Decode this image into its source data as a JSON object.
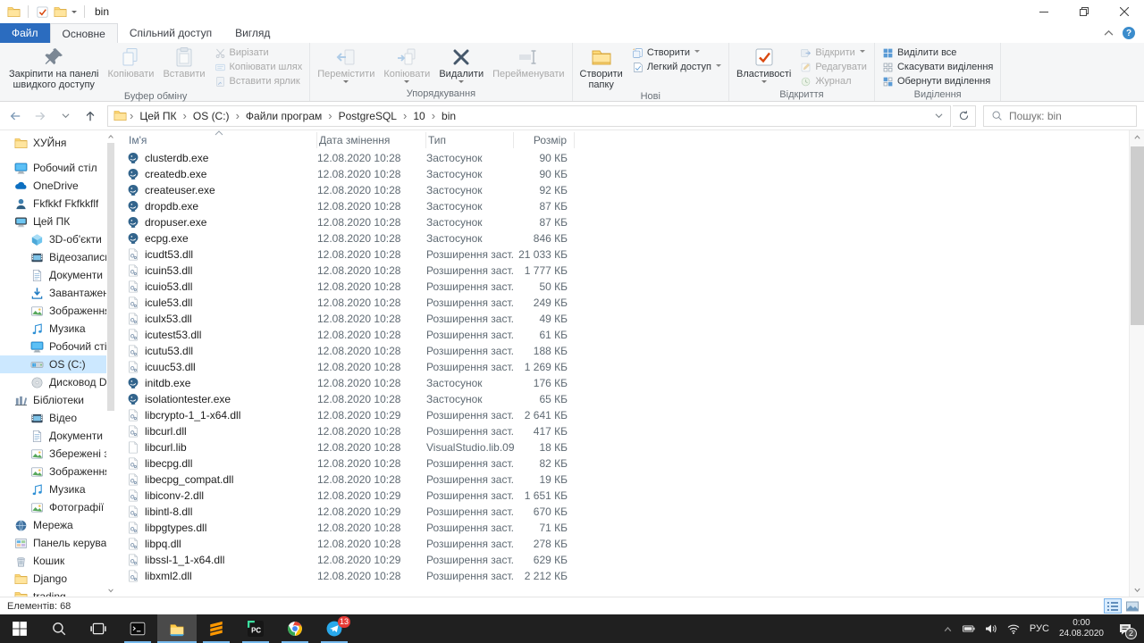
{
  "window": {
    "title": "bin"
  },
  "ribbon": {
    "tabs": [
      {
        "label": "Файл",
        "kind": "file"
      },
      {
        "label": "Основне",
        "active": true
      },
      {
        "label": "Спільний доступ"
      },
      {
        "label": "Вигляд"
      }
    ],
    "groups": [
      {
        "label": "Буфер обміну",
        "buttons": [
          {
            "kind": "big",
            "icon": "pin",
            "label": "Закріпити на панелі\nшвидкого доступу",
            "enabled": true
          },
          {
            "kind": "big",
            "icon": "copy",
            "label": "Копіювати",
            "enabled": false
          },
          {
            "kind": "big",
            "icon": "paste",
            "label": "Вставити",
            "enabled": false
          },
          {
            "kind": "stack",
            "items": [
              {
                "icon": "cut",
                "label": "Вирізати",
                "enabled": false
              },
              {
                "icon": "copy-path",
                "label": "Копіювати шлях",
                "enabled": false
              },
              {
                "icon": "paste-shortcut",
                "label": "Вставити ярлик",
                "enabled": false
              }
            ]
          }
        ]
      },
      {
        "label": "Упорядкування",
        "buttons": [
          {
            "kind": "big",
            "icon": "move-to",
            "label": "Перемістити",
            "dropdown": true,
            "enabled": false
          },
          {
            "kind": "big",
            "icon": "copy-to",
            "label": "Копіювати",
            "dropdown": true,
            "enabled": false
          },
          {
            "kind": "big",
            "icon": "delete",
            "label": "Видалити",
            "dropdown": true,
            "enabled": true
          },
          {
            "kind": "big",
            "icon": "rename",
            "label": "Перейменувати",
            "enabled": false
          }
        ]
      },
      {
        "label": "Нові",
        "buttons": [
          {
            "kind": "big",
            "icon": "new-folder",
            "label": "Створити\nпапку",
            "enabled": true
          },
          {
            "kind": "stack",
            "items": [
              {
                "icon": "new-item",
                "label": "Створити",
                "dropdown": true,
                "enabled": true
              },
              {
                "icon": "easy-access",
                "label": "Легкий доступ",
                "dropdown": true,
                "enabled": true
              }
            ]
          }
        ]
      },
      {
        "label": "Відкриття",
        "buttons": [
          {
            "kind": "big",
            "icon": "properties",
            "label": "Властивості",
            "dropdown": true,
            "enabled": true
          },
          {
            "kind": "stack",
            "items": [
              {
                "icon": "open",
                "label": "Відкрити",
                "dropdown": true,
                "enabled": false
              },
              {
                "icon": "edit",
                "label": "Редагувати",
                "enabled": false
              },
              {
                "icon": "history",
                "label": "Журнал",
                "enabled": false
              }
            ]
          }
        ]
      },
      {
        "label": "Виділення",
        "buttons": [
          {
            "kind": "stack",
            "items": [
              {
                "icon": "select-all",
                "label": "Виділити все",
                "enabled": true
              },
              {
                "icon": "select-none",
                "label": "Скасувати виділення",
                "enabled": true
              },
              {
                "icon": "invert-selection",
                "label": "Обернути виділення",
                "enabled": true
              }
            ]
          }
        ]
      }
    ]
  },
  "address_bar": {
    "breadcrumb": [
      "Цей ПК",
      "OS (C:)",
      "Файли програм",
      "PostgreSQL",
      "10",
      "bin"
    ],
    "search_text": "Пошук: bin"
  },
  "sidebar": {
    "items": [
      {
        "label": "ХУЙня",
        "icon": "folder",
        "indent": 1
      },
      {
        "label": "Робочий стіл",
        "icon": "desktop",
        "indent": 1,
        "gap_before": true
      },
      {
        "label": "OneDrive",
        "icon": "onedrive",
        "indent": 1
      },
      {
        "label": "Fkfkkf Fkfkkflf",
        "icon": "user",
        "indent": 1
      },
      {
        "label": "Цей ПК",
        "icon": "this-pc",
        "indent": 1
      },
      {
        "label": "3D-об'єкти",
        "icon": "cube",
        "indent": 2
      },
      {
        "label": "Відеозаписи",
        "icon": "videos",
        "indent": 2
      },
      {
        "label": "Документи",
        "icon": "documents",
        "indent": 2
      },
      {
        "label": "Завантаження",
        "icon": "downloads",
        "indent": 2
      },
      {
        "label": "Зображення",
        "icon": "pictures",
        "indent": 2
      },
      {
        "label": "Музика",
        "icon": "music",
        "indent": 2
      },
      {
        "label": "Робочий стіл",
        "icon": "desktop",
        "indent": 2
      },
      {
        "label": "OS (C:)",
        "icon": "drive-os",
        "indent": 2,
        "selected": true
      },
      {
        "label": "Дисковод DVD",
        "icon": "dvd",
        "indent": 2
      },
      {
        "label": "Бібліотеки",
        "icon": "libraries",
        "indent": 1
      },
      {
        "label": "Відео",
        "icon": "videos",
        "indent": 2
      },
      {
        "label": "Документи",
        "icon": "documents",
        "indent": 2
      },
      {
        "label": "Збережені зоб",
        "icon": "pictures",
        "indent": 2
      },
      {
        "label": "Зображення",
        "icon": "pictures",
        "indent": 2
      },
      {
        "label": "Музика",
        "icon": "music",
        "indent": 2
      },
      {
        "label": "Фотографії з к",
        "icon": "pictures",
        "indent": 2
      },
      {
        "label": "Мережа",
        "icon": "network",
        "indent": 1
      },
      {
        "label": "Панель керуван",
        "icon": "control-panel",
        "indent": 1
      },
      {
        "label": "Кошик",
        "icon": "recycle-bin",
        "indent": 1
      },
      {
        "label": "Django",
        "icon": "folder",
        "indent": 1
      },
      {
        "label": "trading",
        "icon": "folder",
        "indent": 1
      }
    ]
  },
  "files": {
    "columns": [
      "Ім'я",
      "Дата змінення",
      "Тип",
      "Розмір"
    ],
    "rows": [
      {
        "name": "clusterdb.exe",
        "date": "12.08.2020 10:28",
        "type": "Застосунок",
        "size": "90 КБ",
        "icon": "pg-elephant"
      },
      {
        "name": "createdb.exe",
        "date": "12.08.2020 10:28",
        "type": "Застосунок",
        "size": "90 КБ",
        "icon": "pg-elephant"
      },
      {
        "name": "createuser.exe",
        "date": "12.08.2020 10:28",
        "type": "Застосунок",
        "size": "92 КБ",
        "icon": "pg-elephant"
      },
      {
        "name": "dropdb.exe",
        "date": "12.08.2020 10:28",
        "type": "Застосунок",
        "size": "87 КБ",
        "icon": "pg-elephant"
      },
      {
        "name": "dropuser.exe",
        "date": "12.08.2020 10:28",
        "type": "Застосунок",
        "size": "87 КБ",
        "icon": "pg-elephant"
      },
      {
        "name": "ecpg.exe",
        "date": "12.08.2020 10:28",
        "type": "Застосунок",
        "size": "846 КБ",
        "icon": "pg-elephant"
      },
      {
        "name": "icudt53.dll",
        "date": "12.08.2020 10:28",
        "type": "Розширення заст...",
        "size": "21 033 КБ",
        "icon": "dll-file"
      },
      {
        "name": "icuin53.dll",
        "date": "12.08.2020 10:28",
        "type": "Розширення заст...",
        "size": "1 777 КБ",
        "icon": "dll-file"
      },
      {
        "name": "icuio53.dll",
        "date": "12.08.2020 10:28",
        "type": "Розширення заст...",
        "size": "50 КБ",
        "icon": "dll-file"
      },
      {
        "name": "icule53.dll",
        "date": "12.08.2020 10:28",
        "type": "Розширення заст...",
        "size": "249 КБ",
        "icon": "dll-file"
      },
      {
        "name": "iculx53.dll",
        "date": "12.08.2020 10:28",
        "type": "Розширення заст...",
        "size": "49 КБ",
        "icon": "dll-file"
      },
      {
        "name": "icutest53.dll",
        "date": "12.08.2020 10:28",
        "type": "Розширення заст...",
        "size": "61 КБ",
        "icon": "dll-file"
      },
      {
        "name": "icutu53.dll",
        "date": "12.08.2020 10:28",
        "type": "Розширення заст...",
        "size": "188 КБ",
        "icon": "dll-file"
      },
      {
        "name": "icuuc53.dll",
        "date": "12.08.2020 10:28",
        "type": "Розширення заст...",
        "size": "1 269 КБ",
        "icon": "dll-file"
      },
      {
        "name": "initdb.exe",
        "date": "12.08.2020 10:28",
        "type": "Застосунок",
        "size": "176 КБ",
        "icon": "pg-elephant"
      },
      {
        "name": "isolationtester.exe",
        "date": "12.08.2020 10:28",
        "type": "Застосунок",
        "size": "65 КБ",
        "icon": "pg-elephant"
      },
      {
        "name": "libcrypto-1_1-x64.dll",
        "date": "12.08.2020 10:29",
        "type": "Розширення заст...",
        "size": "2 641 КБ",
        "icon": "dll-file"
      },
      {
        "name": "libcurl.dll",
        "date": "12.08.2020 10:28",
        "type": "Розширення заст...",
        "size": "417 КБ",
        "icon": "dll-file"
      },
      {
        "name": "libcurl.lib",
        "date": "12.08.2020 10:28",
        "type": "VisualStudio.lib.09...",
        "size": "18 КБ",
        "icon": "lib-file"
      },
      {
        "name": "libecpg.dll",
        "date": "12.08.2020 10:28",
        "type": "Розширення заст...",
        "size": "82 КБ",
        "icon": "dll-file"
      },
      {
        "name": "libecpg_compat.dll",
        "date": "12.08.2020 10:28",
        "type": "Розширення заст...",
        "size": "19 КБ",
        "icon": "dll-file"
      },
      {
        "name": "libiconv-2.dll",
        "date": "12.08.2020 10:29",
        "type": "Розширення заст...",
        "size": "1 651 КБ",
        "icon": "dll-file"
      },
      {
        "name": "libintl-8.dll",
        "date": "12.08.2020 10:29",
        "type": "Розширення заст...",
        "size": "670 КБ",
        "icon": "dll-file"
      },
      {
        "name": "libpgtypes.dll",
        "date": "12.08.2020 10:28",
        "type": "Розширення заст...",
        "size": "71 КБ",
        "icon": "dll-file"
      },
      {
        "name": "libpq.dll",
        "date": "12.08.2020 10:28",
        "type": "Розширення заст...",
        "size": "278 КБ",
        "icon": "dll-file"
      },
      {
        "name": "libssl-1_1-x64.dll",
        "date": "12.08.2020 10:29",
        "type": "Розширення заст...",
        "size": "629 КБ",
        "icon": "dll-file"
      },
      {
        "name": "libxml2.dll",
        "date": "12.08.2020 10:28",
        "type": "Розширення заст...",
        "size": "2 212 КБ",
        "icon": "dll-file"
      }
    ]
  },
  "status_bar": {
    "count": "Елементів: 68"
  },
  "taskbar": {
    "apps": [
      {
        "icon": "start"
      },
      {
        "icon": "tb-search"
      },
      {
        "icon": "task-view"
      },
      {
        "icon": "cmd",
        "running": true
      },
      {
        "icon": "explorer",
        "running": true,
        "active": true
      },
      {
        "icon": "sublime",
        "running": true
      },
      {
        "icon": "pycharm",
        "running": true
      },
      {
        "icon": "chrome",
        "running": true
      },
      {
        "icon": "telegram",
        "running": true,
        "badge": "13"
      }
    ],
    "tray": {
      "language": "РУС",
      "time": "0:00",
      "date": "24.08.2020",
      "notification_badge": "2"
    }
  }
}
